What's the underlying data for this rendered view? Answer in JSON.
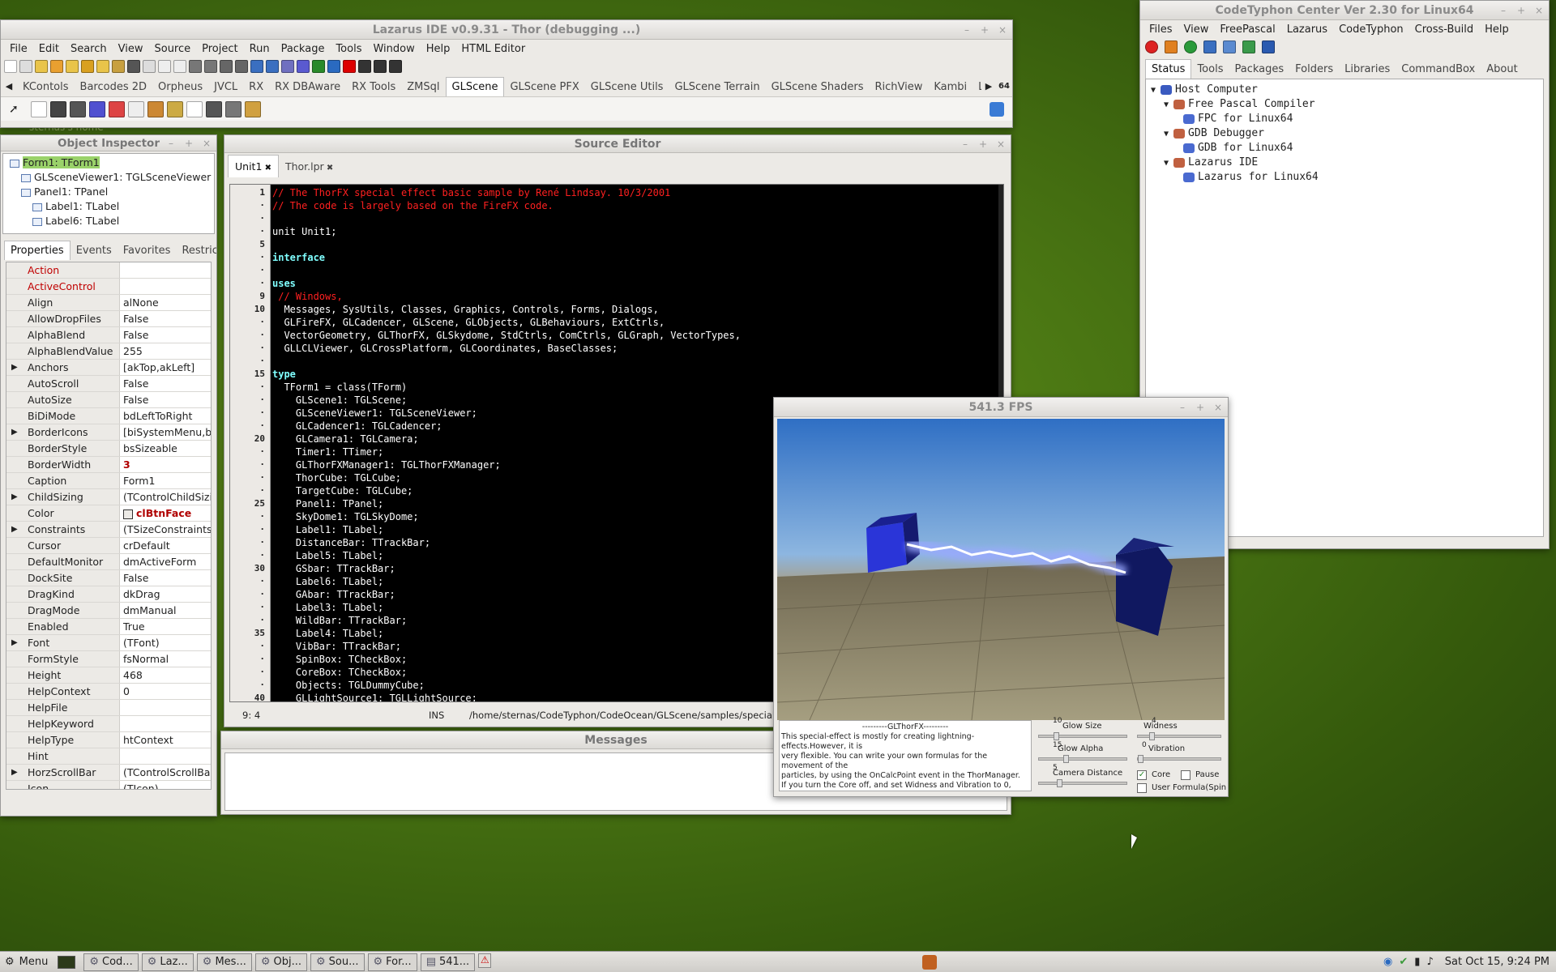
{
  "lazarus": {
    "title": "Lazarus IDE v0.9.31 - Thor (debugging ...)",
    "menus": [
      "File",
      "Edit",
      "Search",
      "View",
      "Source",
      "Project",
      "Run",
      "Package",
      "Tools",
      "Window",
      "Help",
      "HTML Editor"
    ],
    "palette_tabs": [
      "KContols",
      "Barcodes 2D",
      "Orpheus",
      "JVCL",
      "RX",
      "RX DBAware",
      "RX Tools",
      "ZMSql",
      "GLScene",
      "GLScene PFX",
      "GLScene Utils",
      "GLScene Terrain",
      "GLScene Shaders",
      "RichView",
      "Kambi",
      "LAVA"
    ],
    "active_palette_tab": "GLScene",
    "palette_badge": "64"
  },
  "object_inspector": {
    "title": "Object Inspector",
    "tree": [
      {
        "label": "Form1: TForm1",
        "indent": 0,
        "selected": true
      },
      {
        "label": "GLSceneViewer1: TGLSceneViewer",
        "indent": 1
      },
      {
        "label": "Panel1: TPanel",
        "indent": 1
      },
      {
        "label": "Label1: TLabel",
        "indent": 2
      },
      {
        "label": "Label6: TLabel",
        "indent": 2
      }
    ],
    "tabs": [
      "Properties",
      "Events",
      "Favorites",
      "Restricted"
    ],
    "properties": [
      {
        "name": "Action",
        "value": "",
        "red": true
      },
      {
        "name": "ActiveControl",
        "value": "",
        "red": true
      },
      {
        "name": "Align",
        "value": "alNone"
      },
      {
        "name": "AllowDropFiles",
        "value": "False"
      },
      {
        "name": "AlphaBlend",
        "value": "False"
      },
      {
        "name": "AlphaBlendValue",
        "value": "255"
      },
      {
        "name": "Anchors",
        "value": "[akTop,akLeft]",
        "exp": true
      },
      {
        "name": "AutoScroll",
        "value": "False"
      },
      {
        "name": "AutoSize",
        "value": "False"
      },
      {
        "name": "BiDiMode",
        "value": "bdLeftToRight"
      },
      {
        "name": "BorderIcons",
        "value": "[biSystemMenu,b",
        "exp": true
      },
      {
        "name": "BorderStyle",
        "value": "bsSizeable"
      },
      {
        "name": "BorderWidth",
        "value": "3",
        "valred": true
      },
      {
        "name": "Caption",
        "value": "Form1"
      },
      {
        "name": "ChildSizing",
        "value": "(TControlChildSizi",
        "exp": true
      },
      {
        "name": "Color",
        "value": "clBtnFace",
        "valred": true,
        "swatch": true
      },
      {
        "name": "Constraints",
        "value": "(TSizeConstraints",
        "exp": true
      },
      {
        "name": "Cursor",
        "value": "crDefault"
      },
      {
        "name": "DefaultMonitor",
        "value": "dmActiveForm"
      },
      {
        "name": "DockSite",
        "value": "False"
      },
      {
        "name": "DragKind",
        "value": "dkDrag"
      },
      {
        "name": "DragMode",
        "value": "dmManual"
      },
      {
        "name": "Enabled",
        "value": "True"
      },
      {
        "name": "Font",
        "value": "(TFont)",
        "exp": true
      },
      {
        "name": "FormStyle",
        "value": "fsNormal"
      },
      {
        "name": "Height",
        "value": "468"
      },
      {
        "name": "HelpContext",
        "value": "0"
      },
      {
        "name": "HelpFile",
        "value": ""
      },
      {
        "name": "HelpKeyword",
        "value": ""
      },
      {
        "name": "HelpType",
        "value": "htContext"
      },
      {
        "name": "Hint",
        "value": ""
      },
      {
        "name": "HorzScrollBar",
        "value": "(TControlScrollBar",
        "exp": true
      },
      {
        "name": "Icon",
        "value": "(TIcon)"
      }
    ]
  },
  "source_editor": {
    "title": "Source Editor",
    "tabs": [
      "Unit1",
      "Thor.lpr"
    ],
    "gutter": [
      "1",
      "·",
      "·",
      "·",
      "5",
      "·",
      "·",
      "·",
      "9",
      "10",
      "·",
      "·",
      "·",
      "·",
      "15",
      "·",
      "·",
      "·",
      "·",
      "20",
      "·",
      "·",
      "·",
      "·",
      "25",
      "·",
      "·",
      "·",
      "·",
      "30",
      "·",
      "·",
      "·",
      "·",
      "35",
      "·",
      "·",
      "·",
      "·",
      "40"
    ],
    "lines": [
      {
        "t": "// The ThorFX special effect basic sample by René Lindsay. 10/3/2001",
        "c": "cm"
      },
      {
        "t": "// The code is largely based on the FireFX code.",
        "c": "cm"
      },
      {
        "t": "",
        "c": "n"
      },
      {
        "t": "unit Unit1;",
        "c": "n"
      },
      {
        "t": "",
        "c": "n"
      },
      {
        "t": "interface",
        "c": "kw"
      },
      {
        "t": "",
        "c": "n"
      },
      {
        "t": "uses",
        "c": "kw"
      },
      {
        "t": " // Windows,",
        "c": "cm"
      },
      {
        "t": "  Messages, SysUtils, Classes, Graphics, Controls, Forms, Dialogs,",
        "c": "n"
      },
      {
        "t": "  GLFireFX, GLCadencer, GLScene, GLObjects, GLBehaviours, ExtCtrls,",
        "c": "n"
      },
      {
        "t": "  VectorGeometry, GLThorFX, GLSkydome, StdCtrls, ComCtrls, GLGraph, VectorTypes,",
        "c": "n"
      },
      {
        "t": "  GLLCLViewer, GLCrossPlatform, GLCoordinates, BaseClasses;",
        "c": "n"
      },
      {
        "t": "",
        "c": "n"
      },
      {
        "t": "type",
        "c": "kw"
      },
      {
        "t": "  TForm1 = class(TForm)",
        "c": "n"
      },
      {
        "t": "    GLScene1: TGLScene;",
        "c": "n"
      },
      {
        "t": "    GLSceneViewer1: TGLSceneViewer;",
        "c": "n"
      },
      {
        "t": "    GLCadencer1: TGLCadencer;",
        "c": "n"
      },
      {
        "t": "    GLCamera1: TGLCamera;",
        "c": "n"
      },
      {
        "t": "    Timer1: TTimer;",
        "c": "n"
      },
      {
        "t": "    GLThorFXManager1: TGLThorFXManager;",
        "c": "n"
      },
      {
        "t": "    ThorCube: TGLCube;",
        "c": "n"
      },
      {
        "t": "    TargetCube: TGLCube;",
        "c": "n"
      },
      {
        "t": "    Panel1: TPanel;",
        "c": "n"
      },
      {
        "t": "    SkyDome1: TGLSkyDome;",
        "c": "n"
      },
      {
        "t": "    Label1: TLabel;",
        "c": "n"
      },
      {
        "t": "    DistanceBar: TTrackBar;",
        "c": "n"
      },
      {
        "t": "    Label5: TLabel;",
        "c": "n"
      },
      {
        "t": "    GSbar: TTrackBar;",
        "c": "n"
      },
      {
        "t": "    Label6: TLabel;",
        "c": "n"
      },
      {
        "t": "    GAbar: TTrackBar;",
        "c": "n"
      },
      {
        "t": "    Label3: TLabel;",
        "c": "n"
      },
      {
        "t": "    WildBar: TTrackBar;",
        "c": "n"
      },
      {
        "t": "    Label4: TLabel;",
        "c": "n"
      },
      {
        "t": "    VibBar: TTrackBar;",
        "c": "n"
      },
      {
        "t": "    SpinBox: TCheckBox;",
        "c": "n"
      },
      {
        "t": "    CoreBox: TCheckBox;",
        "c": "n"
      },
      {
        "t": "    Objects: TGLDummyCube;",
        "c": "n"
      },
      {
        "t": "    GLLightSource1: TGLLightSource;",
        "c": "n"
      }
    ],
    "status_pos": "9: 4",
    "status_mode": "INS",
    "status_path": "/home/sternas/CodeTyphon/CodeOcean/GLScene/samples/specialsFX"
  },
  "messages": {
    "title": "Messages"
  },
  "typhon": {
    "title": "CodeTyphon Center Ver 2.30 for Linux64",
    "menus": [
      "Files",
      "View",
      "FreePascal",
      "Lazarus",
      "CodeTyphon",
      "Cross-Build",
      "Help"
    ],
    "tabs": [
      "Status",
      "Tools",
      "Packages",
      "Folders",
      "Libraries",
      "CommandBox",
      "About"
    ],
    "tree": [
      {
        "label": "Host Computer",
        "indent": 0
      },
      {
        "label": "Free Pascal Compiler",
        "indent": 1
      },
      {
        "label": "FPC for Linux64",
        "indent": 2
      },
      {
        "label": "GDB Debugger",
        "indent": 1
      },
      {
        "label": "GDB for Linux64",
        "indent": 2
      },
      {
        "label": "Lazarus IDE",
        "indent": 1
      },
      {
        "label": "Lazarus for Linux64",
        "indent": 2
      }
    ]
  },
  "fps_window": {
    "title": "541.3 FPS",
    "memo_lines": [
      "---------GLThorFX---------",
      "This special-effect is mostly for creating lightning-",
      "effects.However, it is",
      "very flexible. You can write your own formulas for the",
      "movement of the",
      "particles, by using the OnCalcPoint event in the ThorManager.",
      "If you turn the Core off, and set Widness and Vibration to 0,"
    ],
    "glow_size_label": "Glow Size",
    "glow_size_value": "10",
    "widness_label": "Widness",
    "widness_value": "4",
    "glow_alpha_label": "Glow Alpha",
    "glow_alpha_value": "15",
    "vibration_label": "Vibration",
    "vibration_value": "0",
    "camera_distance_label": "Camera Distance",
    "camera_distance_value": "5",
    "core_label": "Core",
    "core_checked": true,
    "pause_label": "Pause",
    "pause_checked": false,
    "user_formula_label": "User Formula(Spin"
  },
  "desktop": {
    "overlay_text": "sternas's home"
  },
  "taskbar": {
    "menu_label": "Menu",
    "tasks": [
      "Cod...",
      "Laz...",
      "Mes...",
      "Obj...",
      "Sou...",
      "For...",
      "541..."
    ],
    "clock": "Sat Oct 15,  9:24 PM"
  }
}
